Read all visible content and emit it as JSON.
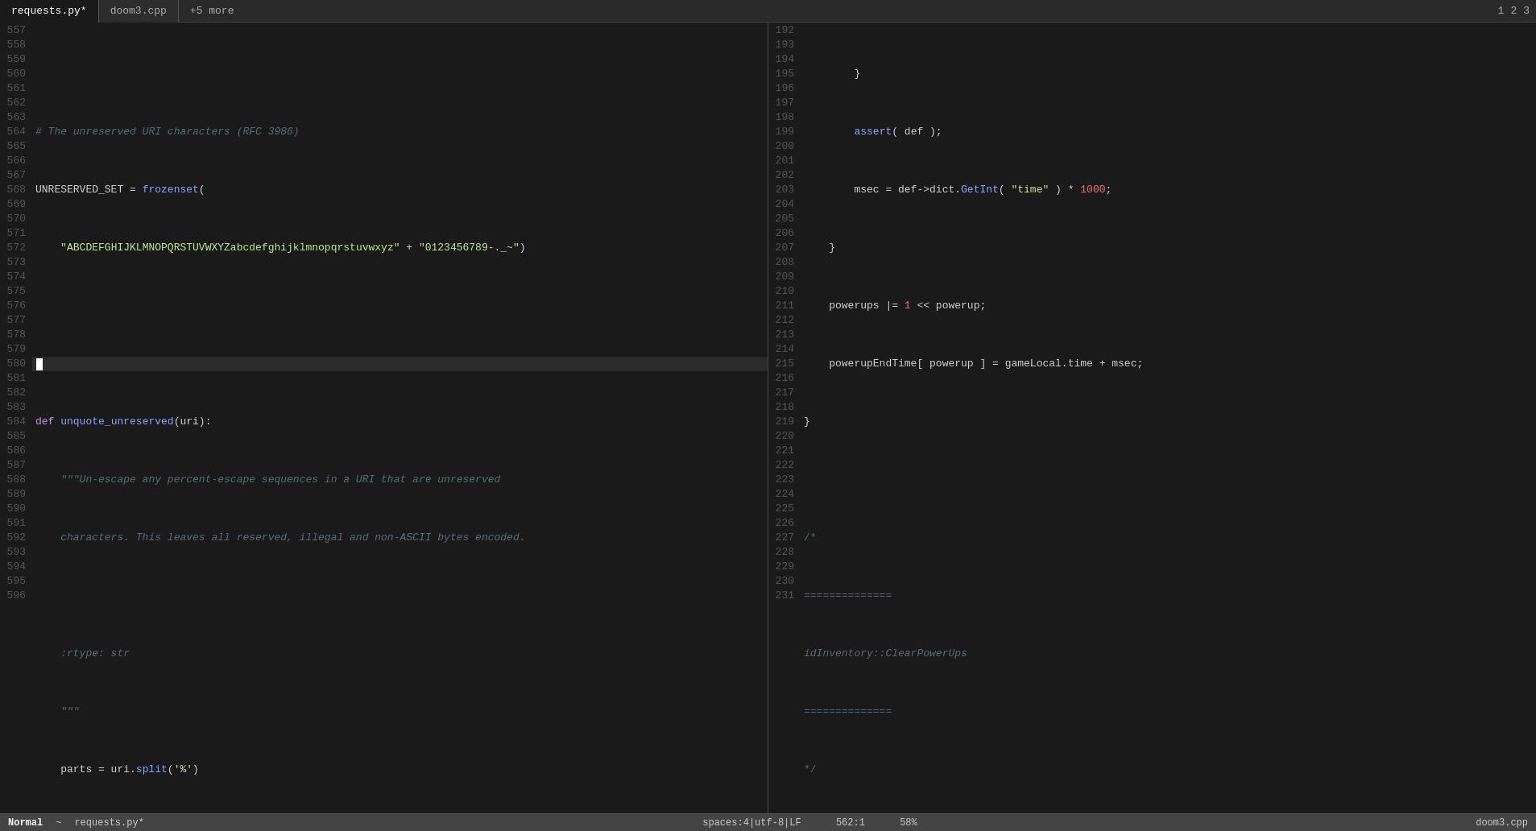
{
  "tabs": {
    "left": [
      {
        "label": "requests.py*",
        "active": true
      },
      {
        "label": "doom3.cpp",
        "active": false
      },
      {
        "label": "+5 more",
        "active": false
      }
    ],
    "window_numbers": [
      "1",
      "2",
      "3"
    ]
  },
  "status_bar_left": {
    "mode": "Normal",
    "tilde": "~",
    "filename": "requests.py*"
  },
  "status_bar_right": {
    "encoding": "spaces:4|utf-8|LF",
    "position": "562:1",
    "percent": "58%",
    "right_filename": "doom3.cpp"
  }
}
